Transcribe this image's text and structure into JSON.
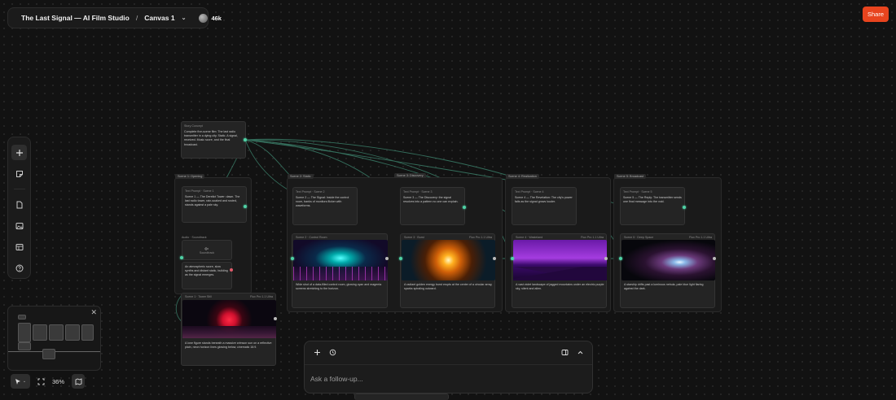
{
  "header": {
    "project_title": "The Last Signal — AI Film Studio",
    "separator": "/",
    "canvas_name": "Canvas 1",
    "credits": "46k"
  },
  "share_label": "Share",
  "toolbar": {
    "items": [
      "add-icon",
      "sticky-note-icon",
      "document-icon",
      "image-icon",
      "layout-icon",
      "help-icon"
    ]
  },
  "zoom": {
    "level": "36%"
  },
  "chat": {
    "placeholder": "Ask a follow-up..."
  },
  "colors": {
    "accent": "#e8441e",
    "connector": "#4fd1a5",
    "background": "#121212"
  },
  "nodes": {
    "root": {
      "header": "Story Concept",
      "text": "Complete five-scene film: The last radio transmitter in a dying city. Static. A signal, received. Music score, and the final broadcast."
    },
    "scenes": [
      {
        "tag": "Scene 1: Opening",
        "prompt_header": "Text Prompt · Scene 1",
        "prompt": "Scene 1 — The Derelict Tower: dawn. The last radio tower, rain-soaked and rusted, stands against a pale sky.",
        "image_header": "Scene 1 · Tower Still",
        "image_meta": "Flux Pro 1.1 Ultra",
        "desc": "A lone figure stands beneath a massive crimson sun on a reflective plain, neon horizon lines glowing below, cinematic 16:9."
      },
      {
        "tag": "Scene 2: Static",
        "prompt_header": "Text Prompt · Scene 2",
        "prompt": "Scene 2 — The Signal: Inside the control room, banks of monitors flicker with waveforms.",
        "image_header": "Scene 2 · Control Room",
        "image_meta": "Flux Pro 1.1 Ultra",
        "desc": "Wide shot of a data-filled control room, glowing cyan and magenta screens stretching to the horizon."
      },
      {
        "tag": "Scene 3: Discovery",
        "prompt_header": "Text Prompt · Scene 3",
        "prompt": "Scene 3 — The Discovery: the signal resolves into a pattern no one can explain.",
        "image_header": "Scene 3 · Burst",
        "image_meta": "Flux Pro 1.1 Ultra",
        "desc": "A radiant golden energy burst erupts at the center of a circular array, sparks spiraling outward."
      },
      {
        "tag": "Scene 4: Realization",
        "prompt_header": "Text Prompt · Scene 4",
        "prompt": "Scene 4 — The Revelation: The city's power fails as the signal grows louder.",
        "image_header": "Scene 4 · Wasteland",
        "image_meta": "Flux Pro 1.1 Ultra",
        "desc": "A vast violet landscape of jagged mountains under an electric purple sky, silent and alien."
      },
      {
        "tag": "Scene 5: Broadcast",
        "prompt_header": "Text Prompt · Scene 5",
        "prompt": "Scene 5 — The Reply: The transmitter sends one final message into the void.",
        "image_header": "Scene 5 · Deep Space",
        "image_meta": "Flux Pro 1.1 Ultra",
        "desc": "A starship drifts past a luminous nebula, pale blue light flaring against the dark."
      }
    ],
    "audio": {
      "header": "Audio · Soundtrack",
      "meta": "Music Gen v1.5",
      "label": "Soundtrack",
      "text": "An atmospheric score, slow synths and distant static, building as the signal emerges."
    }
  }
}
